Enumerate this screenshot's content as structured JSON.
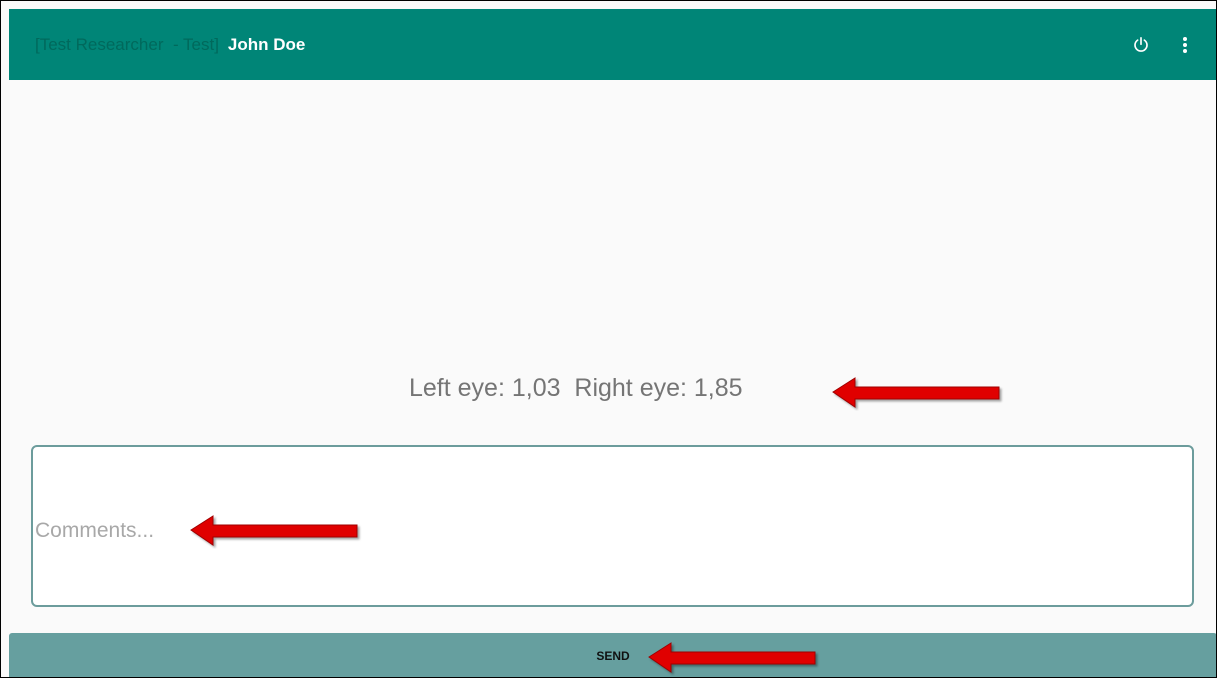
{
  "appbar": {
    "prefix": "[Test Researcher  - Test]",
    "user_name": "John Doe",
    "power_icon": "power-icon",
    "menu_icon": "more-vert-icon"
  },
  "result": {
    "text": "Left eye: 1,03  Right eye: 1,85"
  },
  "comments": {
    "placeholder": "Comments...",
    "value": ""
  },
  "send_button": {
    "label": "SEND"
  },
  "colors": {
    "appbar": "#008577",
    "send_button": "#669f9f",
    "annotation_arrow": "#e00000"
  },
  "annotations": [
    {
      "name": "annotation-arrow-result",
      "icon": "red-arrow-left-icon"
    },
    {
      "name": "annotation-arrow-comments",
      "icon": "red-arrow-left-icon"
    },
    {
      "name": "annotation-arrow-send",
      "icon": "red-arrow-left-icon"
    }
  ]
}
